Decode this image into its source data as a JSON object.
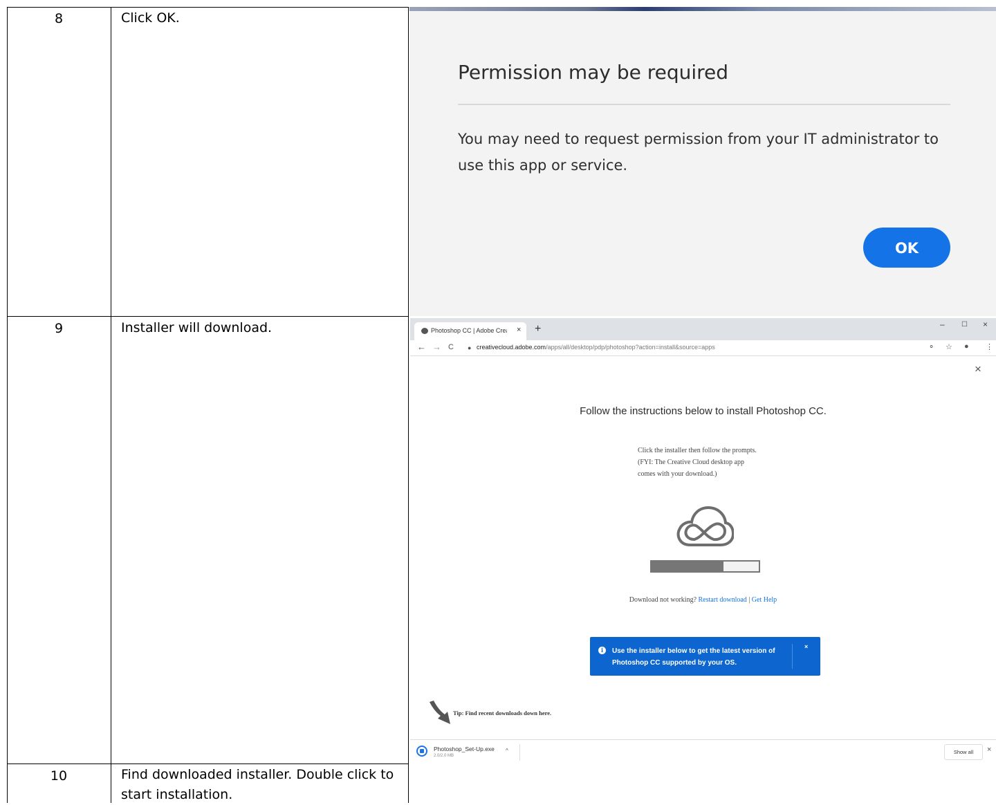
{
  "steps": [
    {
      "number": "8",
      "text": "Click OK."
    },
    {
      "number": "9",
      "text": "Installer will download."
    },
    {
      "number": "10",
      "text": "Find downloaded installer. Double click to start installation."
    }
  ],
  "dialog": {
    "title": "Permission may be required",
    "body": "You may need to request permission from your IT administrator to use this app or service.",
    "ok_label": "OK",
    "accent_color": "#1473e6"
  },
  "browser": {
    "tab_title": "Photoshop CC | Adobe Creative Cloud",
    "tab_close": "×",
    "new_tab": "+",
    "window_controls": {
      "minimize": "–",
      "maximize": "☐",
      "close": "×"
    },
    "nav": {
      "back": "←",
      "forward": "→",
      "reload": "C"
    },
    "url_host": "creativecloud.adobe.com",
    "url_path": "/apps/all/desktop/pdp/photoshop?action=install&source=apps",
    "toolbar_icons": [
      "key-icon",
      "star-icon",
      "profile-icon",
      "menu-icon"
    ],
    "page": {
      "close": "×",
      "title": "Follow the instructions below to install Photoshop CC.",
      "sub_lines": [
        "Click the installer then follow the prompts.",
        "(FYI: The Creative Cloud desktop app",
        "comes with your download.)"
      ],
      "progress": 0.67,
      "download_issue_prefix": "Download not working?",
      "restart_link": "Restart download",
      "separator": "|",
      "help_link": "Get Help",
      "toast_icon": "i",
      "toast_text": "Use the installer below to get the latest version of Photoshop CC supported by your OS.",
      "toast_close": "×",
      "tip": "Tip: Find recent downloads down here."
    },
    "download_shelf": {
      "file_name": "Photoshop_Set-Up.exe",
      "file_size": "2.0/2.0 MB",
      "caret": "^",
      "show_all": "Show all",
      "close": "×"
    }
  }
}
